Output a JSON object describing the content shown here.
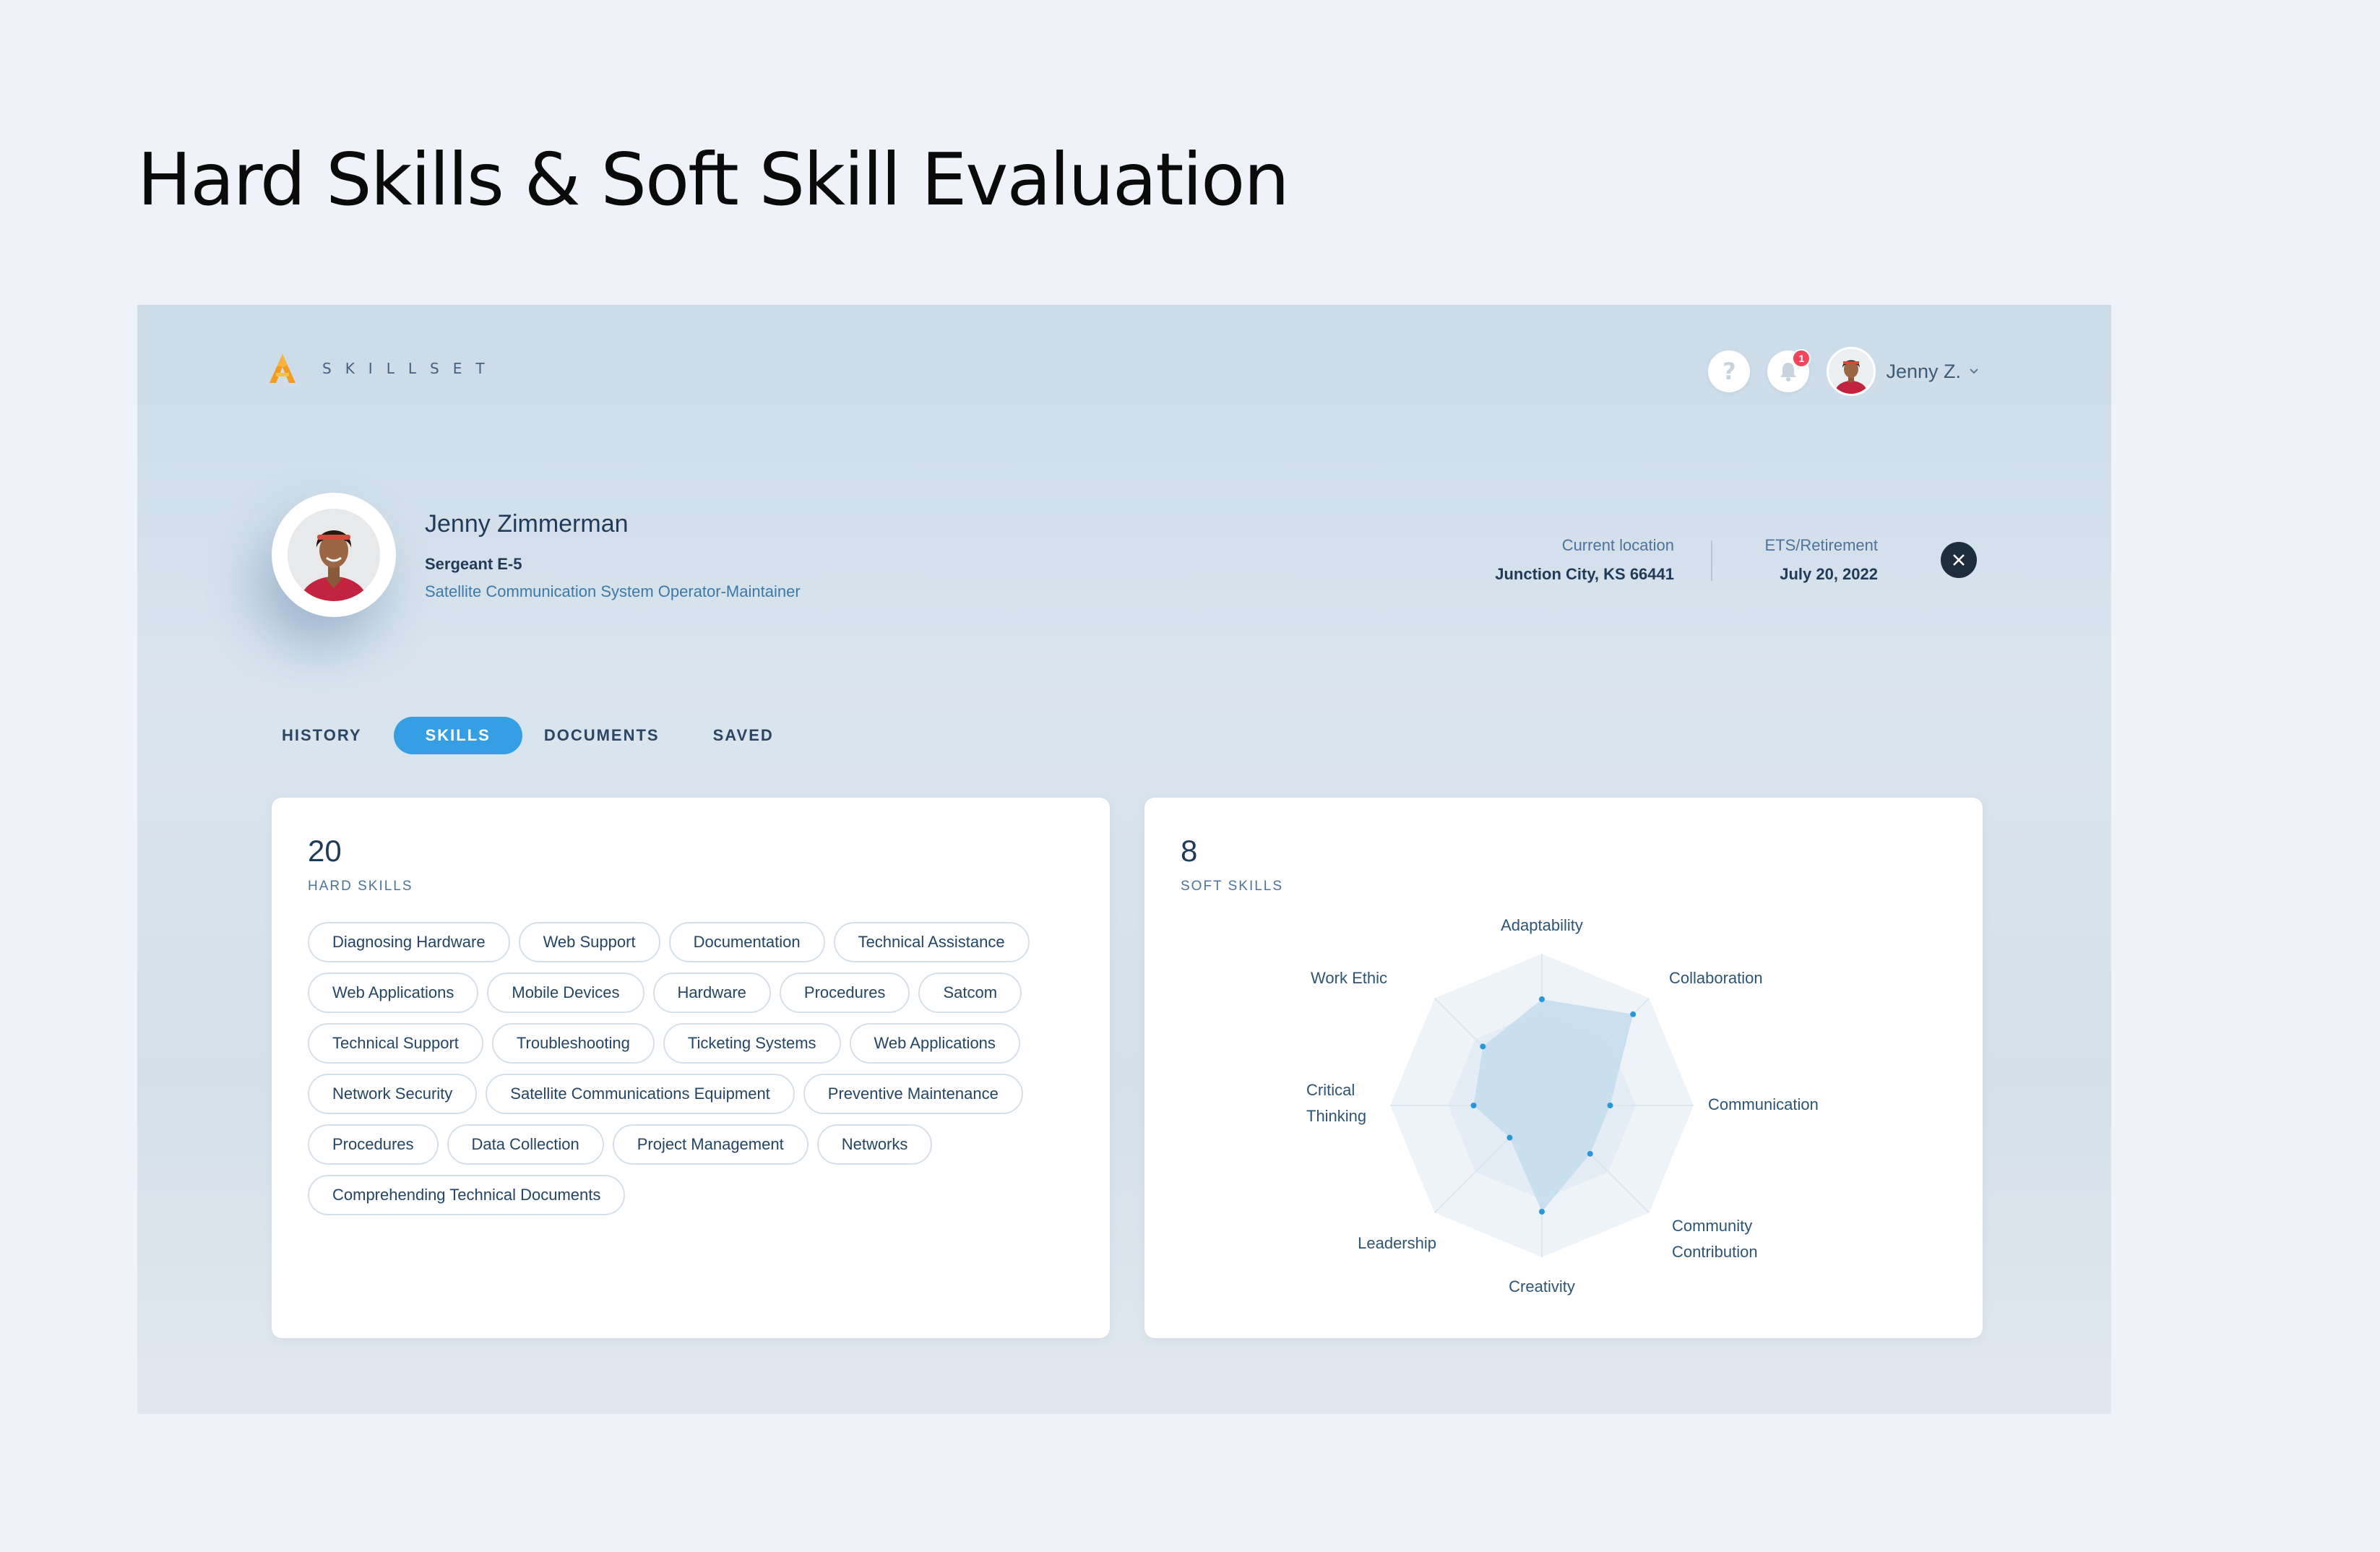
{
  "page_title": "Hard Skills & Soft Skill Evaluation",
  "app": {
    "logo_text": "SKILLSET",
    "notification_count": "1",
    "user_short": "Jenny Z."
  },
  "profile": {
    "name": "Jenny Zimmerman",
    "rank": "Sergeant E-5",
    "role": "Satellite Communication System Operator-Maintainer",
    "location_label": "Current location",
    "location_value": "Junction City, KS 66441",
    "ets_label": "ETS/Retirement",
    "ets_value": "July 20, 2022"
  },
  "tabs": [
    {
      "label": "HISTORY",
      "active": false
    },
    {
      "label": "SKILLS",
      "active": true
    },
    {
      "label": "DOCUMENTS",
      "active": false
    },
    {
      "label": "SAVED",
      "active": false
    }
  ],
  "hard_skills": {
    "count": "20",
    "label": "HARD SKILLS",
    "items": [
      "Diagnosing Hardware",
      "Web Support",
      "Documentation",
      "Technical Assistance",
      "Web Applications",
      "Mobile Devices",
      "Hardware",
      "Procedures",
      "Satcom",
      "Technical Support",
      "Troubleshooting",
      "Ticketing Systems",
      "Web Applications",
      "Network Security",
      "Satellite Communications Equipment",
      "Preventive Maintenance",
      "Procedures",
      "Data Collection",
      "Project Management",
      "Networks",
      "Comprehending Technical Documents"
    ]
  },
  "soft_skills": {
    "count": "8",
    "label": "SOFT SKILLS"
  },
  "chart_data": {
    "type": "radar",
    "categories": [
      "Adaptability",
      "Collaboration",
      "Communication",
      "Community Contribution",
      "Creativity",
      "Leadership",
      "Critical Thinking",
      "Work Ethic"
    ],
    "values": [
      0.7,
      0.85,
      0.45,
      0.45,
      0.7,
      0.3,
      0.45,
      0.55
    ],
    "max": 1,
    "accent": "#2b97d6",
    "fill": "#c3dced"
  }
}
